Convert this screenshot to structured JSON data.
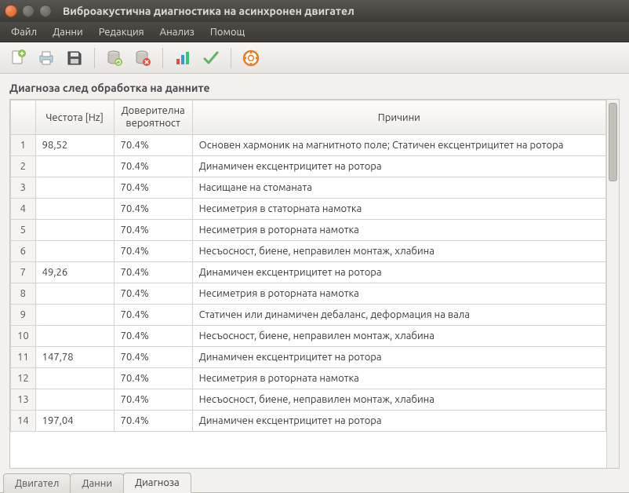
{
  "window": {
    "title": "Виброакустична диагностика на  асинхронен двигател"
  },
  "menu": {
    "file": "Файл",
    "data": "Данни",
    "edit": "Редакция",
    "analysis": "Анализ",
    "help": "Помощ"
  },
  "section_title": "Диагноза след обработка на данните",
  "columns": {
    "row": "",
    "frequency": "Честота [Hz]",
    "probability": "Доверителна вероятност",
    "cause": "Причини"
  },
  "rows": [
    {
      "n": "1",
      "freq": "98,52",
      "prob": "70.4%",
      "cause": "Основен хармоник на магнитното поле; Статичен ексцентрицитет на ротора"
    },
    {
      "n": "2",
      "freq": "",
      "prob": "70.4%",
      "cause": "Динамичен ексцентрицитет на ротора"
    },
    {
      "n": "3",
      "freq": "",
      "prob": "70.4%",
      "cause": "Насищане на стоманата"
    },
    {
      "n": "4",
      "freq": "",
      "prob": "70.4%",
      "cause": "Несиметрия в статорната намотка"
    },
    {
      "n": "5",
      "freq": "",
      "prob": "70.4%",
      "cause": "Несиметрия в роторната намотка"
    },
    {
      "n": "6",
      "freq": "",
      "prob": "70.4%",
      "cause": "Несъосност, биене, неправилен монтаж, хлабина"
    },
    {
      "n": "7",
      "freq": "49,26",
      "prob": "70.4%",
      "cause": "Динамичен ексцентрицитет на ротора"
    },
    {
      "n": "8",
      "freq": "",
      "prob": "70.4%",
      "cause": "Несиметрия в роторната намотка"
    },
    {
      "n": "9",
      "freq": "",
      "prob": "70.4%",
      "cause": "Статичен или динамичен дебаланс, деформация на вала"
    },
    {
      "n": "10",
      "freq": "",
      "prob": "70.4%",
      "cause": "Несъосност, биене, неправилен монтаж, хлабина"
    },
    {
      "n": "11",
      "freq": "147,78",
      "prob": "70.4%",
      "cause": "Динамичен ексцентрицитет на ротора"
    },
    {
      "n": "12",
      "freq": "",
      "prob": "70.4%",
      "cause": "Несиметрия в роторната намотка"
    },
    {
      "n": "13",
      "freq": "",
      "prob": "70.4%",
      "cause": "Несъосност, биене, неправилен монтаж, хлабина"
    },
    {
      "n": "14",
      "freq": "197,04",
      "prob": "70.4%",
      "cause": "Динамичен ексцентрицитет на ротора"
    }
  ],
  "tabs": {
    "engine": "Двигател",
    "data": "Данни",
    "diagnosis": "Диагноза"
  }
}
